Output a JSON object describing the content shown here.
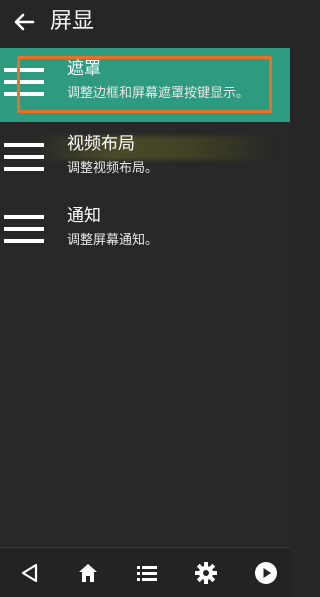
{
  "header": {
    "title": "屏显",
    "back_icon": "arrow-left-icon"
  },
  "menu": {
    "items": [
      {
        "title": "遮罩",
        "desc": "调整边框和屏幕遮罩按键显示。",
        "icon": "hamburger-icon",
        "selected": true
      },
      {
        "title": "视频布局",
        "desc": "调整视频布局。",
        "icon": "hamburger-icon",
        "selected": false
      },
      {
        "title": "通知",
        "desc": "调整屏幕通知。",
        "icon": "hamburger-icon",
        "selected": false
      }
    ]
  },
  "bottom_bar": {
    "icons": [
      "back-triangle-icon",
      "home-icon",
      "list-icon",
      "gear-icon",
      "play-icon"
    ]
  },
  "colors": {
    "background": "#282828",
    "header": "#262626",
    "selected": "#2e9b80",
    "focus_frame": "#e8712a",
    "text": "#ffffff"
  }
}
